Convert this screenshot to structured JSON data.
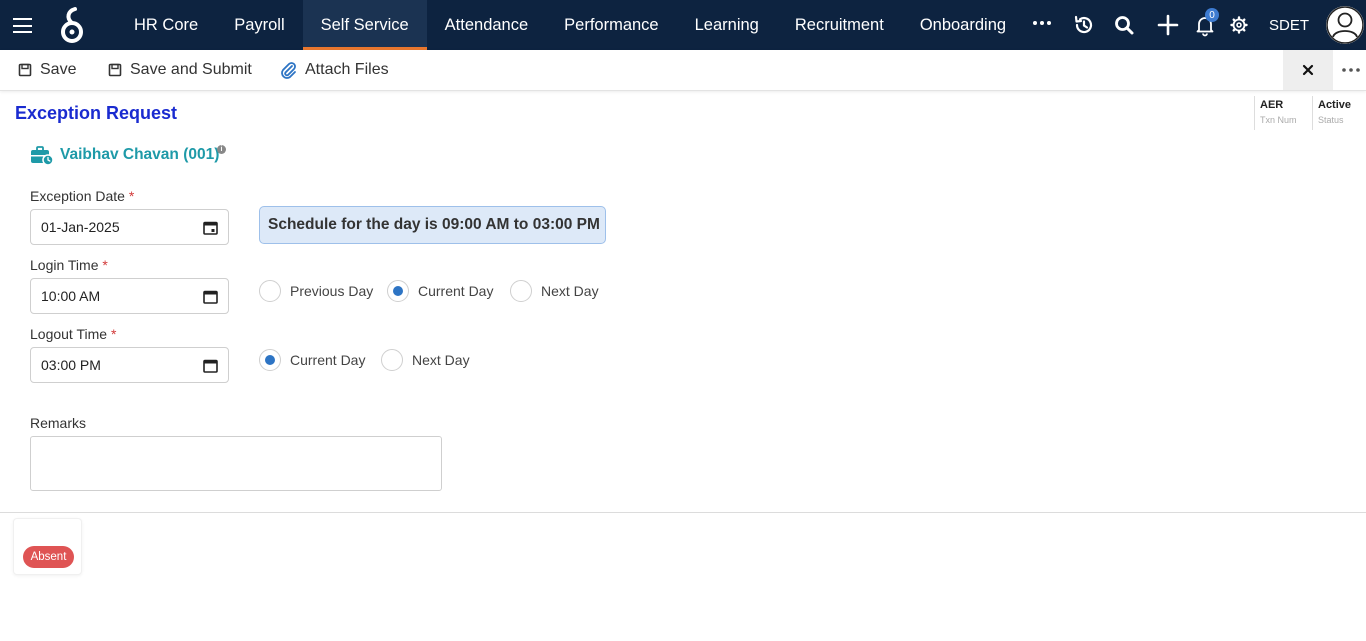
{
  "nav": {
    "tabs": [
      {
        "label": "HR Core"
      },
      {
        "label": "Payroll"
      },
      {
        "label": "Self Service",
        "active": true
      },
      {
        "label": "Attendance"
      },
      {
        "label": "Performance"
      },
      {
        "label": "Learning"
      },
      {
        "label": "Recruitment"
      },
      {
        "label": "Onboarding"
      }
    ],
    "icons": [
      "more-horizontal-icon",
      "history-icon",
      "search-icon",
      "plus-icon",
      "bell-icon",
      "gear-icon"
    ],
    "notification_count": "0",
    "user_label": "SDET"
  },
  "toolbar": {
    "save_label": "Save",
    "save_submit_label": "Save and Submit",
    "attach_label": "Attach Files"
  },
  "header": {
    "title": "Exception Request",
    "txn_num_value": "AER",
    "txn_num_label": "Txn Num",
    "status_value": "Active",
    "status_label": "Status"
  },
  "employee": {
    "name": "Vaibhav Chavan (001)",
    "info_symbol": "i"
  },
  "form": {
    "exception_date": {
      "label": "Exception Date",
      "value": "01-Jan-2025"
    },
    "login_time": {
      "label": "Login Time",
      "value": "10:00 AM",
      "options": [
        "Previous Day",
        "Current Day",
        "Next Day"
      ],
      "selected": "Current Day"
    },
    "logout_time": {
      "label": "Logout Time",
      "value": "03:00 PM",
      "options": [
        "Current Day",
        "Next Day"
      ],
      "selected": "Current Day"
    },
    "required_mark": "*",
    "schedule_text": "Schedule for the day is 09:00 AM to 03:00 PM",
    "remarks": {
      "label": "Remarks",
      "value": ""
    }
  },
  "status_badge": {
    "label": "Absent",
    "color": "#df5454"
  },
  "colors": {
    "nav_bg": "#0d2340",
    "active_tab_underline": "#e8772e",
    "title": "#1a2bd0",
    "employee_name": "#1e9aa8",
    "radio_selected": "#2d74c4"
  }
}
